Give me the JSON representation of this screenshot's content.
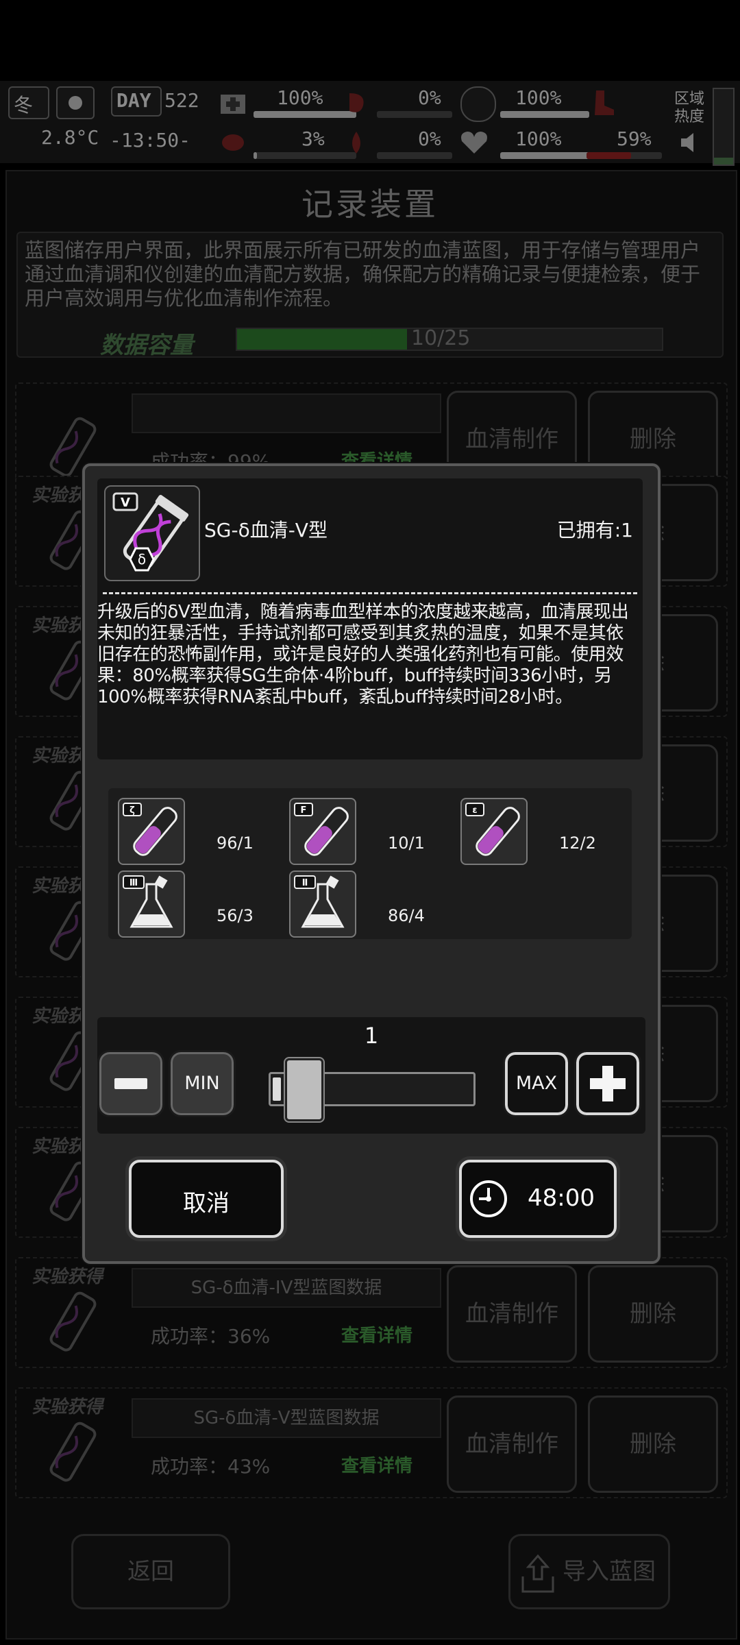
{
  "hud": {
    "season": "冬",
    "temperature": "2.8°C",
    "day_label": "DAY",
    "day_value": "522",
    "clock": "-13:50-",
    "stats": [
      {
        "value": "100%",
        "fill": 1.0
      },
      {
        "value": "3%",
        "fill": 0.03
      },
      {
        "value": "0%",
        "fill": 0.0
      },
      {
        "value": "0%",
        "fill": 0.0
      },
      {
        "value": "100%",
        "fill": 1.0
      },
      {
        "value": "100%",
        "fill": 1.0
      },
      {
        "value": "59%",
        "fill": 0.59
      }
    ],
    "area_heat_label": "区域热度"
  },
  "screen": {
    "title": "记录装置",
    "description": "蓝图储存用户界面，此界面展示所有已研发的血清蓝图，用于存储与管理用户通过血清调和仪创建的血清配方数据，确保配方的精确记录与便捷检索，便于用户高效调用与优化血清制作流程。",
    "capacity_label": "数据容量",
    "capacity_value": "10/25",
    "capacity_fraction": 0.4,
    "rows": [
      {
        "tag": "",
        "name": "",
        "rate": "成功率：99%",
        "detail": "查看详情"
      },
      {
        "tag": "实验获得",
        "name": "",
        "rate": "",
        "detail": ""
      },
      {
        "tag": "实验获得",
        "name": "",
        "rate": "",
        "detail": ""
      },
      {
        "tag": "实验获得",
        "name": "",
        "rate": "",
        "detail": ""
      },
      {
        "tag": "实验获得",
        "name": "",
        "rate": "",
        "detail": ""
      },
      {
        "tag": "实验获得",
        "name": "",
        "rate": "",
        "detail": ""
      },
      {
        "tag": "实验获得",
        "name": "",
        "rate": "",
        "detail": ""
      },
      {
        "tag": "实验获得",
        "name": "SG-δ血清-IV型蓝图数据",
        "rate": "成功率：36%",
        "detail": "查看详情"
      },
      {
        "tag": "实验获得",
        "name": "SG-δ血清-V型蓝图数据",
        "rate": "成功率：43%",
        "detail": "查看详情"
      }
    ],
    "make_label": "血清制作",
    "delete_label": "删除",
    "delete_partial": "除",
    "back_label": "返回",
    "import_label": "导入蓝图"
  },
  "modal": {
    "item_name": "SG-δ血清-V型",
    "owned": "已拥有:1",
    "icon_roman": "V",
    "icon_greek": "δ",
    "description": "升级后的δV型血清，随着病毒血型样本的浓度越来越高，血清展现出未知的狂暴活性，手持试剂都可感受到其炙热的温度，如果不是其依旧存在的恐怖副作用，或许是良好的人类强化药剂也有可能。使用效果：80%概率获得SG生命体·4阶buff，buff持续时间336小时，另100%概率获得RNA紊乱中buff，紊乱buff持续时间28小时。",
    "ingredients": [
      {
        "symbol": "ζ",
        "type": "test-tube",
        "count": "96/1"
      },
      {
        "symbol": "F",
        "type": "test-tube",
        "count": "10/1"
      },
      {
        "symbol": "ε",
        "type": "test-tube",
        "count": "12/2"
      },
      {
        "symbol": "Ⅲ",
        "type": "flask",
        "count": "56/3"
      },
      {
        "symbol": "Ⅱ",
        "type": "flask",
        "count": "86/4"
      }
    ],
    "quantity": "1",
    "quantity_fraction": 0.0,
    "min_label": "MIN",
    "max_label": "MAX",
    "cancel_label": "取消",
    "time_label": "48:00"
  },
  "colors": {
    "modal_bg": "#262626",
    "accent_purple": "#c040d8",
    "capacity_green": "#1c4a1c"
  }
}
